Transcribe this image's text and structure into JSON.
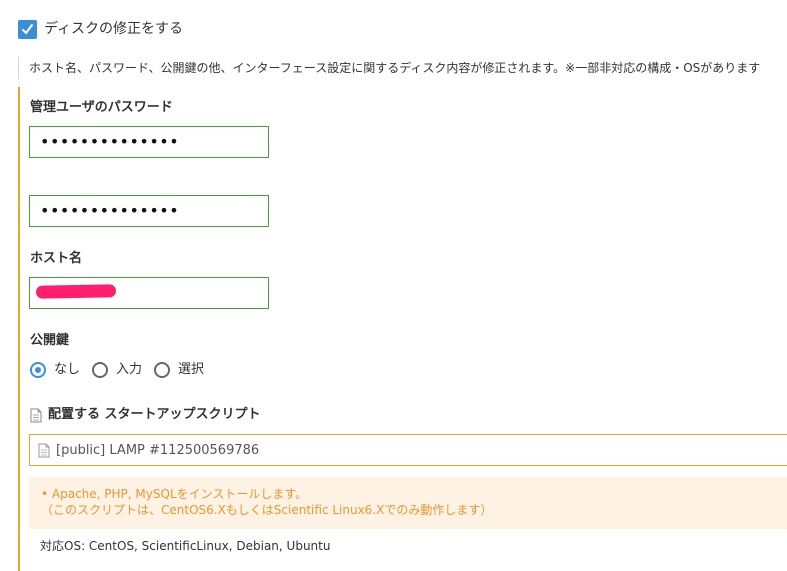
{
  "disk_fix": {
    "checked": true,
    "label": "ディスクの修正をする",
    "description": "ホスト名、パスワード、公開鍵の他、インターフェース設定に関するディスク内容が修正されます。※一部非対応の構成・OSがあります"
  },
  "password": {
    "label": "管理ユーザのパスワード",
    "value_masked": "••••••••••••••",
    "confirm_masked": "••••••••••••••"
  },
  "hostname": {
    "label": "ホスト名"
  },
  "public_key": {
    "label": "公開鍵",
    "options": [
      "なし",
      "入力",
      "選択"
    ],
    "selected": "なし"
  },
  "startup_script": {
    "title": "配置する スタートアップスクリプト",
    "selected": "[public] LAMP #112500569786",
    "note_line1": "Apache, PHP, MySQLをインストールします。",
    "note_line2": "（このスクリプトは、CentOS6.XもしくはScientific Linux6.Xでのみ動作します）",
    "supported_os": "対応OS: CentOS, ScientificLinux, Debian, Ubuntu"
  },
  "colors": {
    "accent": "#3b8fd6",
    "input_border": "#4c9a3c",
    "section_border": "#e6a82a",
    "note_bg": "#fdf2e4",
    "note_text": "#e8992e"
  }
}
